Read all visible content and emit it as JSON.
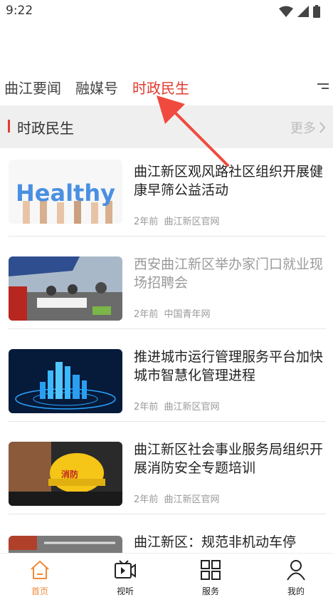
{
  "status_bar": {
    "time": "9:22"
  },
  "tabs": [
    {
      "label": "曲江要闻",
      "active": false
    },
    {
      "label": "融媒号",
      "active": false
    },
    {
      "label": "时政民生",
      "active": true
    }
  ],
  "section": {
    "title": "时政民生",
    "more_label": "更多"
  },
  "news": [
    {
      "title": "曲江新区观风路社区组织开展健康早筛公益活动",
      "age": "2年前",
      "source": "曲江新区官网",
      "read": false,
      "thumb_text": "Healthy"
    },
    {
      "title": "西安曲江新区举办家门口就业现场招聘会",
      "age": "2年前",
      "source": "中国青年网",
      "read": true
    },
    {
      "title": "推进城市运行管理服务平台加快城市智慧化管理进程",
      "age": "2年前",
      "source": "曲江新区官网",
      "read": false
    },
    {
      "title": "曲江新区社会事业服务局组织开展消防安全专题培训",
      "age": "2年前",
      "source": "曲江新区官网",
      "read": false,
      "thumb_text": "消防"
    },
    {
      "title": "曲江新区：规范非机动车停",
      "read": false
    }
  ],
  "bottom_nav": [
    {
      "label": "首页",
      "icon": "home-icon",
      "active": true
    },
    {
      "label": "视听",
      "icon": "video-icon",
      "active": false
    },
    {
      "label": "服务",
      "icon": "grid-icon",
      "active": false
    },
    {
      "label": "我的",
      "icon": "user-icon",
      "active": false
    }
  ],
  "colors": {
    "accent": "#e23b30",
    "nav_active": "#f08a3a",
    "header_bg": "#efefef"
  }
}
